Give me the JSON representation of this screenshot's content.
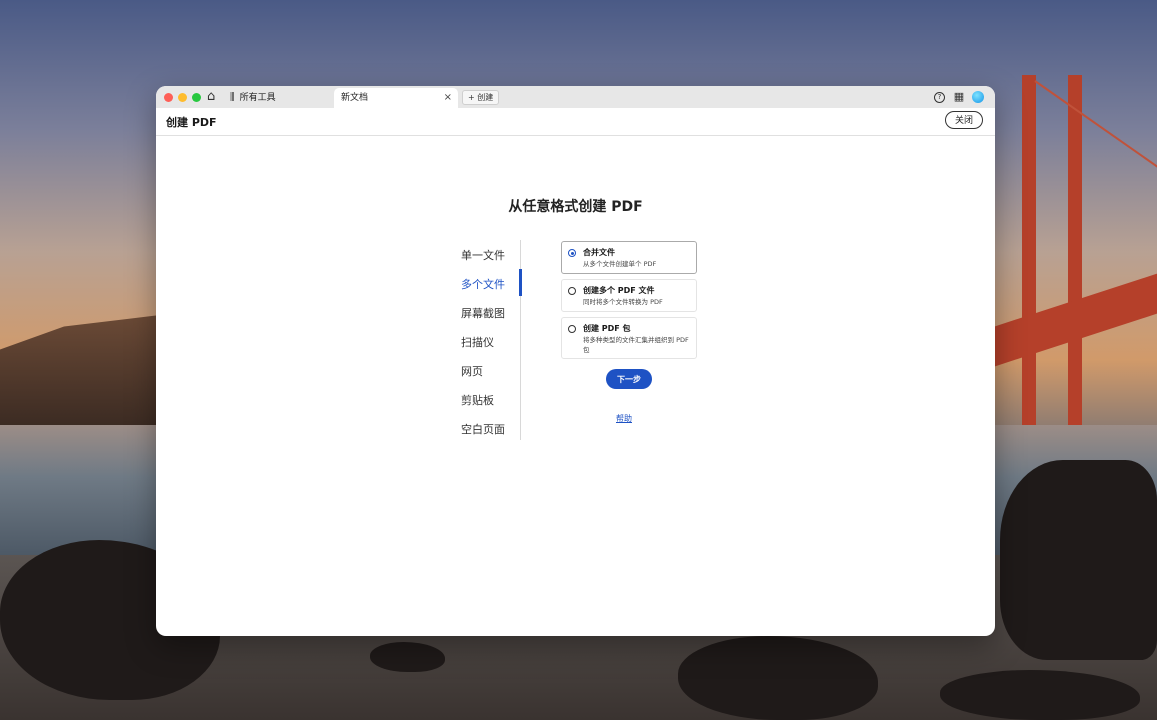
{
  "tabbar": {
    "tools_tab": "所有工具",
    "doc_tab": "新文档",
    "close_symbol": "×",
    "new_tab": "+ 创建"
  },
  "header": {
    "title": "创建 PDF",
    "close_label": "关闭"
  },
  "main": {
    "title": "从任意格式创建 PDF"
  },
  "sidebar": {
    "items": [
      {
        "label": "单一文件",
        "active": false
      },
      {
        "label": "多个文件",
        "active": true
      },
      {
        "label": "屏幕截图",
        "active": false
      },
      {
        "label": "扫描仪",
        "active": false
      },
      {
        "label": "网页",
        "active": false
      },
      {
        "label": "剪贴板",
        "active": false
      },
      {
        "label": "空白页面",
        "active": false
      }
    ]
  },
  "options": [
    {
      "title": "合并文件",
      "desc": "从多个文件创建单个 PDF",
      "selected": true
    },
    {
      "title": "创建多个 PDF 文件",
      "desc": "同时将多个文件转换为 PDF",
      "selected": false
    },
    {
      "title": "创建 PDF 包",
      "desc": "将多种类型的文件汇集并组织到 PDF 包",
      "selected": false
    }
  ],
  "actions": {
    "next_label": "下一步",
    "help_label": "帮助"
  },
  "colors": {
    "accent": "#1e52c4"
  },
  "icons": {
    "home": "home-icon",
    "tools": "tools-icon",
    "help": "help-icon",
    "apps": "apps-grid-icon",
    "avatar": "profile-avatar"
  }
}
